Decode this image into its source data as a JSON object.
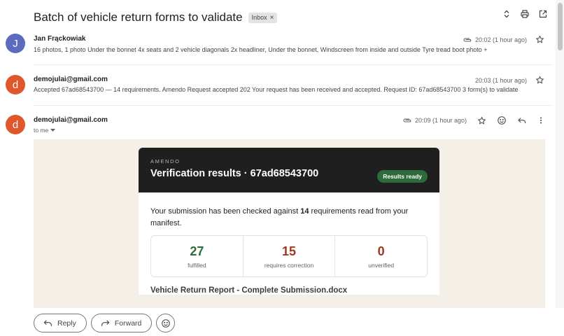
{
  "thread": {
    "subject": "Batch of vehicle return forms to validate",
    "label_chip": "Inbox",
    "label_remove": "×"
  },
  "colors": {
    "avatar_j": "#5c6bc0",
    "avatar_d": "#e0572b",
    "fulfilled": "#2e6b3a",
    "correction": "#a0391f",
    "unverified": "#a0391f",
    "badge": "#2e6b3a"
  },
  "messages": [
    {
      "initial": "J",
      "sender": "Jan Frąckowiak",
      "snippet": "16 photos, 1 photo Under the bonnet 4x seats and 2 vehicle diagonals 2x headliner, Under the bonnet, Windscreen from inside and outside Tyre tread boot photo +",
      "time": "20:02 (1 hour ago)",
      "icons": [
        "attachment-icon",
        "star-icon"
      ]
    },
    {
      "initial": "d",
      "sender": "demojulai@gmail.com",
      "snippet": "Accepted 67ad68543700 — 14 requirements. Amendo Request accepted 202 Your request has been received and accepted. Request ID: 67ad68543700 3 form(s) to validate",
      "time": "20:03 (1 hour ago)",
      "icons": [
        "star-icon"
      ]
    },
    {
      "initial": "d",
      "sender": "demojulai@gmail.com",
      "recipient": "to me",
      "time": "20:09 (1 hour ago)",
      "icons": [
        "attachment-icon",
        "star-icon",
        "emoji-icon",
        "reply-icon",
        "more-vert-icon"
      ]
    }
  ],
  "email": {
    "brand": "AMENDO",
    "title": "Verification results · 67ad68543700",
    "badge": "Results ready",
    "intro_before": "Your submission has been checked against ",
    "intro_count": "14",
    "intro_after": " requirements read from your manifest.",
    "stats": [
      {
        "value": "27",
        "label": "fulfilled"
      },
      {
        "value": "15",
        "label": "requires correction"
      },
      {
        "value": "0",
        "label": "unverified"
      }
    ],
    "attachment_title": "Vehicle Return Report - Complete Submission.docx"
  },
  "actions": {
    "reply": "Reply",
    "forward": "Forward"
  }
}
